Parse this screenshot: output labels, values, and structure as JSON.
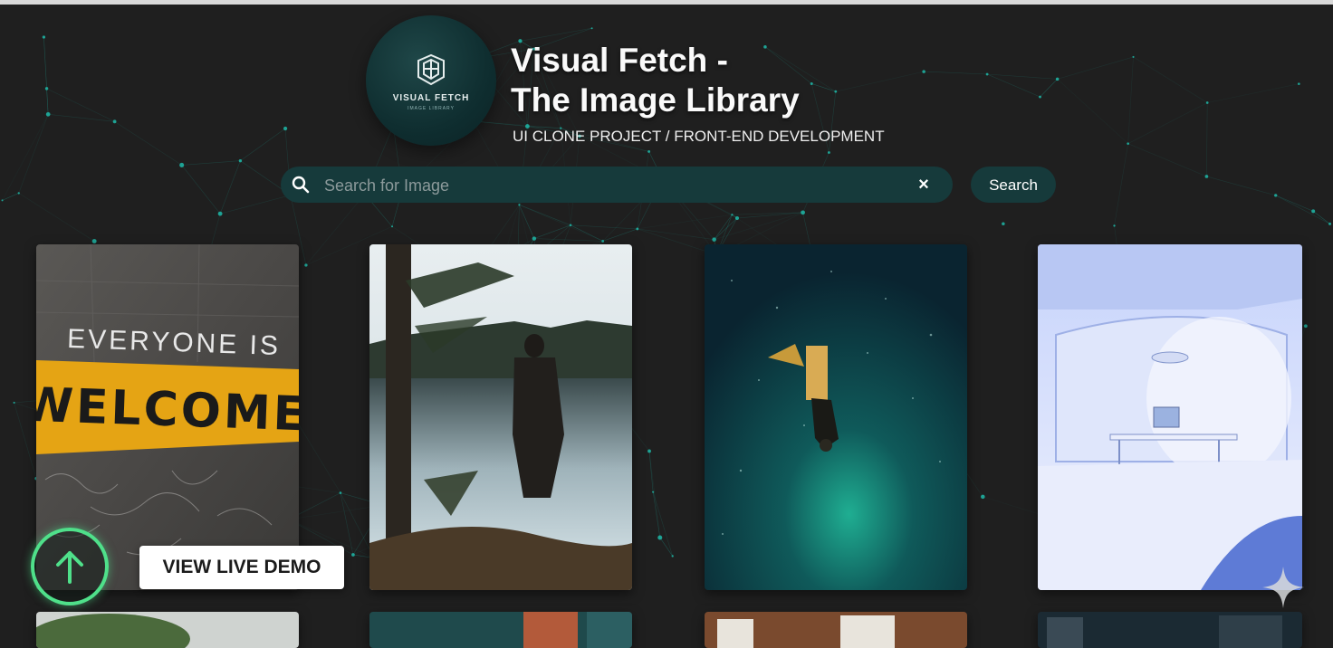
{
  "header": {
    "logo_text": "VISUAL FETCH",
    "logo_subtext": "IMAGE LIBRARY",
    "title_line1": "Visual Fetch -",
    "title_line2": "The Image Library",
    "subtitle": "UI CLONE PROJECT / FRONT-END DEVELOPMENT"
  },
  "search": {
    "placeholder": "Search for Image",
    "value": "",
    "clear_icon": "×",
    "button_label": "Search"
  },
  "gallery": {
    "images": [
      {
        "name": "welcome-sign",
        "text_top": "EVERYONE IS",
        "text_main": "WELCOME"
      },
      {
        "name": "lake-silhouette"
      },
      {
        "name": "underwater-diver"
      },
      {
        "name": "futuristic-room"
      },
      {
        "name": "tree-partial"
      },
      {
        "name": "teal-street-partial"
      },
      {
        "name": "brick-building-partial"
      },
      {
        "name": "city-night-partial"
      }
    ]
  },
  "overlay": {
    "demo_label": "VIEW LIVE DEMO",
    "scroll_icon": "arrow-up-icon",
    "accent_color": "#4fe08a"
  },
  "colors": {
    "background": "#1f1f1f",
    "search_bg": "#163a3b",
    "network_node": "#1fb8a8"
  }
}
